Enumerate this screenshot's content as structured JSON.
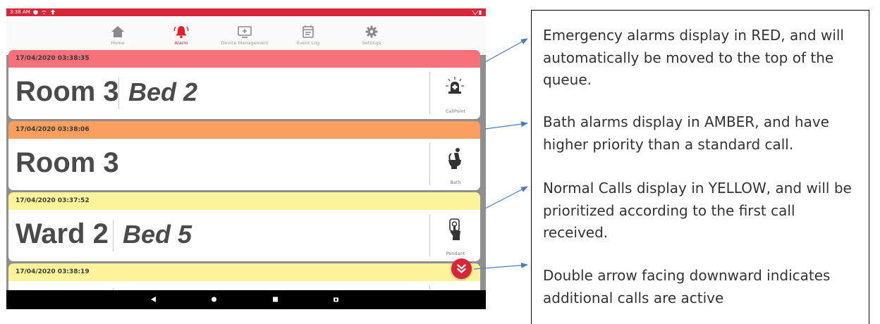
{
  "status_bar": {
    "time": "3:38 AM"
  },
  "nav": {
    "items": [
      {
        "label": "Home",
        "icon": "home-icon"
      },
      {
        "label": "Alarm",
        "icon": "alarm-bell-icon"
      },
      {
        "label": "Device Management",
        "icon": "device-management-icon"
      },
      {
        "label": "Event Log",
        "icon": "event-log-icon"
      },
      {
        "label": "Settings",
        "icon": "settings-gear-icon"
      }
    ]
  },
  "alarms": [
    {
      "timestamp": "17/04/2020 03:38:35",
      "room": "Room 3",
      "bed": "Bed 2",
      "type": "CallPoint",
      "icon": "callpoint-icon",
      "color": "#f8707a",
      "level": "emergency"
    },
    {
      "timestamp": "17/04/2020 03:38:06",
      "room": "Room 3",
      "bed": "",
      "type": "Bath",
      "icon": "bath-toilet-icon",
      "color": "#fc9f5e",
      "level": "bath"
    },
    {
      "timestamp": "17/04/2020 03:37:52",
      "room": "Ward 2",
      "bed": "Bed 5",
      "type": "Pendant",
      "icon": "pendant-icon",
      "color": "#fdf39a",
      "level": "normal"
    },
    {
      "timestamp": "17/04/2020 03:38:19",
      "room": "",
      "bed": "",
      "type": "",
      "icon": "",
      "color": "#fdf39a",
      "level": "normal"
    }
  ],
  "more_button": {
    "icon": "double-chevron-down-icon"
  },
  "android_nav": {
    "icons": [
      "back-icon",
      "home-dot-icon",
      "recents-icon",
      "screenshot-icon"
    ]
  },
  "annotations": [
    {
      "text": "Emergency alarms display in RED, and will automatically be moved to the top of the queue."
    },
    {
      "text": "Bath alarms display in AMBER, and have higher priority than a standard call."
    },
    {
      "text": "Normal Calls display in YELLOW, and will be prioritized according to the first call received."
    },
    {
      "text": "Double arrow facing downward indicates additional calls are active"
    }
  ],
  "colors": {
    "accent": "#d7263a",
    "arrow": "#4a7ebb"
  }
}
